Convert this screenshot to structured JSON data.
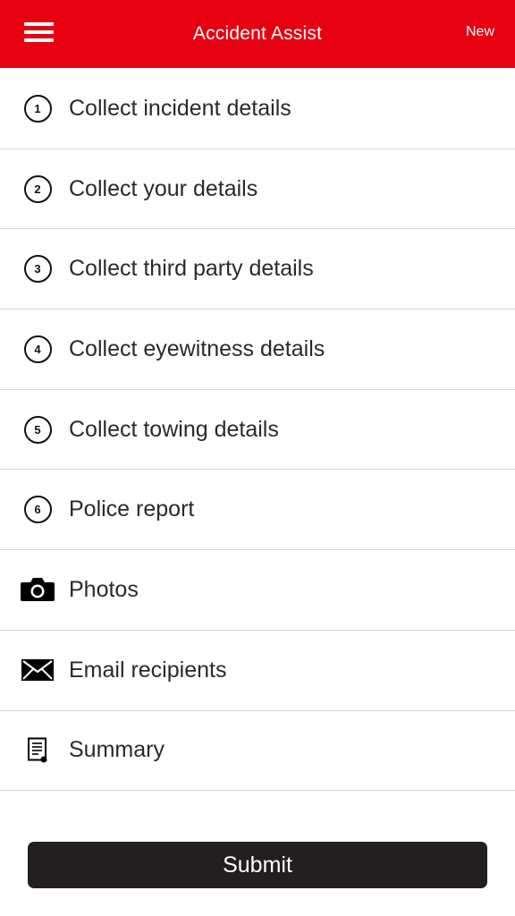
{
  "header": {
    "title": "Accident Assist",
    "new_label": "New",
    "background": "#e60012"
  },
  "items": [
    {
      "icon": "number-1",
      "number": "1",
      "label": "Collect incident details"
    },
    {
      "icon": "number-2",
      "number": "2",
      "label": "Collect your details"
    },
    {
      "icon": "number-3",
      "number": "3",
      "label": "Collect third party details"
    },
    {
      "icon": "number-4",
      "number": "4",
      "label": "Collect eyewitness details"
    },
    {
      "icon": "number-5",
      "number": "5",
      "label": "Collect towing details"
    },
    {
      "icon": "number-6",
      "number": "6",
      "label": "Police report"
    },
    {
      "icon": "camera-icon",
      "label": "Photos"
    },
    {
      "icon": "envelope-icon",
      "label": "Email recipients"
    },
    {
      "icon": "document-icon",
      "label": "Summary"
    }
  ],
  "submit": {
    "label": "Submit",
    "background": "#231f20"
  }
}
